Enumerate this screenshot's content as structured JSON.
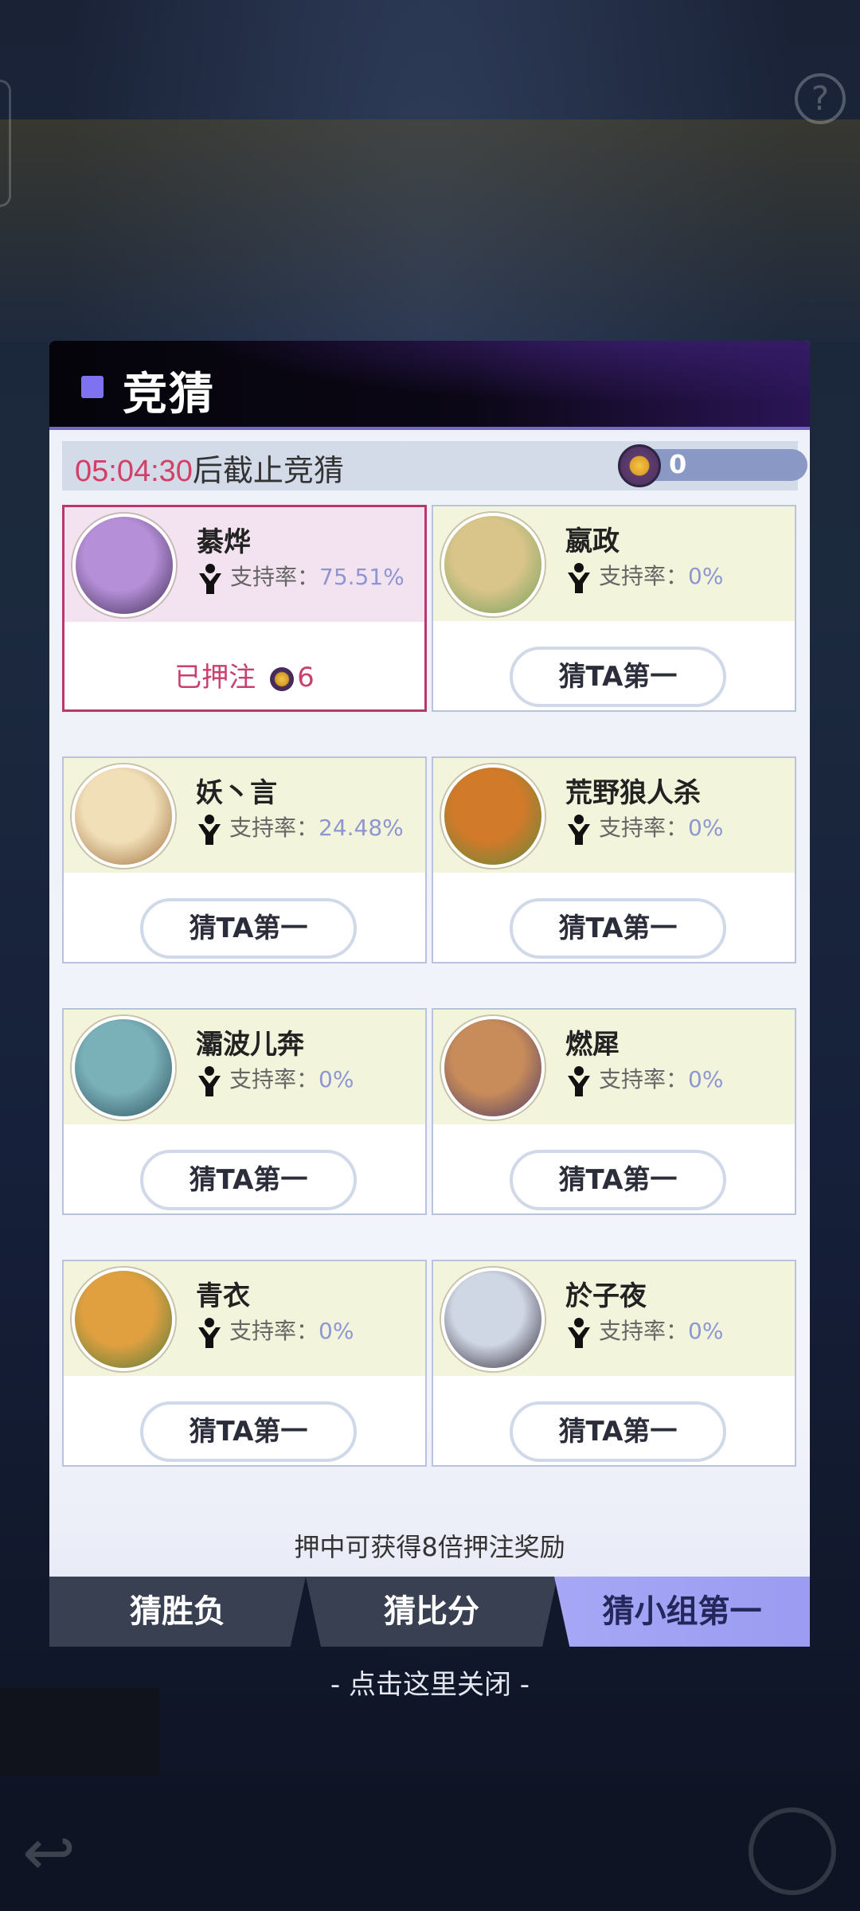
{
  "modal": {
    "title": "竞猜",
    "countdown_time": "05:04:30",
    "countdown_suffix": "后截止竞猜",
    "coin_balance": "0",
    "reward_note": "押中可获得8倍押注奖励"
  },
  "candidates": [
    {
      "name": "綦烨",
      "support_label": "支持率：",
      "support_rate": "75.51%",
      "status": "bet",
      "bet_label": "已押注",
      "bet_amount": "6",
      "avatar_colors": [
        "#b58fd8",
        "#3b2a4d"
      ]
    },
    {
      "name": "嬴政",
      "support_label": "支持率：",
      "support_rate": "0%",
      "status": "open",
      "button_label": "猜TA第一",
      "avatar_colors": [
        "#d9c48a",
        "#6fa05a"
      ]
    },
    {
      "name": "妖丶言",
      "support_label": "支持率：",
      "support_rate": "24.48%",
      "status": "open",
      "button_label": "猜TA第一",
      "avatar_colors": [
        "#f1dfb8",
        "#9b6a38"
      ]
    },
    {
      "name": "荒野狼人杀",
      "support_label": "支持率：",
      "support_rate": "0%",
      "status": "open",
      "button_label": "猜TA第一",
      "avatar_colors": [
        "#d07a2a",
        "#5c8a3a"
      ]
    },
    {
      "name": "灞波儿奔",
      "support_label": "支持率：",
      "support_rate": "0%",
      "status": "open",
      "button_label": "猜TA第一",
      "avatar_colors": [
        "#7ab0b8",
        "#2b4f5c"
      ]
    },
    {
      "name": "燃犀",
      "support_label": "支持率：",
      "support_rate": "0%",
      "status": "open",
      "button_label": "猜TA第一",
      "avatar_colors": [
        "#c88c5a",
        "#4a3a66"
      ]
    },
    {
      "name": "青衣",
      "support_label": "支持率：",
      "support_rate": "0%",
      "status": "open",
      "button_label": "猜TA第一",
      "avatar_colors": [
        "#e0a040",
        "#4e7a3a"
      ]
    },
    {
      "name": "於子夜",
      "support_label": "支持率：",
      "support_rate": "0%",
      "status": "open",
      "button_label": "猜TA第一",
      "avatar_colors": [
        "#cfd6e4",
        "#2a2230"
      ]
    }
  ],
  "tabs": [
    {
      "label": "猜胜负",
      "active": false
    },
    {
      "label": "猜比分",
      "active": false
    },
    {
      "label": "猜小组第一",
      "active": true
    }
  ],
  "close_hint": "- 点击这里关闭 -",
  "colors": {
    "accent": "#7f72f0",
    "countdown": "#d33f66",
    "rate": "#8d96d1",
    "selected_border": "#b33a6a"
  }
}
